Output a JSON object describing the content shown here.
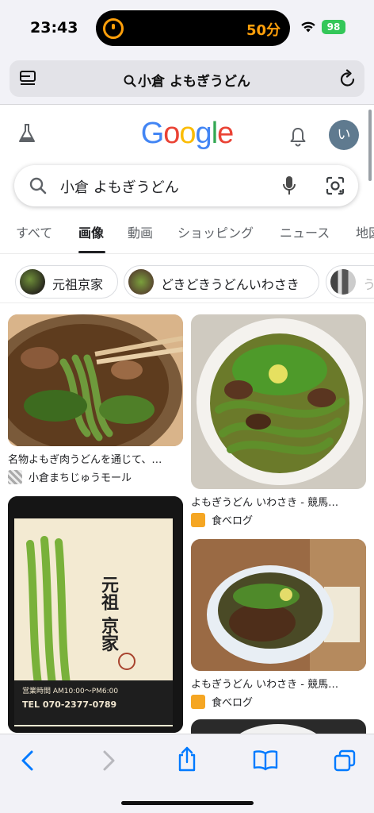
{
  "status_bar": {
    "time": "23:43",
    "activity_text": "50分",
    "battery": "98"
  },
  "browser": {
    "url_text": "小倉 よもぎうどん"
  },
  "google": {
    "logo_letters": [
      "G",
      "o",
      "o",
      "g",
      "l",
      "e"
    ],
    "logo_colors": [
      "#4285F4",
      "#EA4335",
      "#FBBC05",
      "#4285F4",
      "#34A853",
      "#EA4335"
    ],
    "avatar_initial": "い",
    "search_query": "小倉 よもぎうどん"
  },
  "tabs": [
    "すべて",
    "画像",
    "動画",
    "ショッピング",
    "ニュース",
    "地図"
  ],
  "active_tab": "画像",
  "chips": [
    {
      "label": "元祖京家"
    },
    {
      "label": "どきどきうどんいわさき"
    },
    {
      "label": "う"
    }
  ],
  "results": [
    {
      "caption": "名物よもぎ肉うどんを通じて、…",
      "source": "小倉まちじゅうモール"
    },
    {
      "caption": "よもぎうどん いわさき - 競馬…",
      "source": "食べログ"
    },
    {
      "caption": "よもぎうどん いわさき - 競馬…",
      "source": "食べログ"
    }
  ],
  "poster_text": {
    "shop_name": "元祖 京家",
    "hours": "営業時間 AM10:00〜PM6:00",
    "phone": "TEL 070-2377-0789"
  },
  "colors": {
    "accent_orange": "#ff9f0a",
    "ios_blue": "#007aff",
    "tabelog_orange": "#f5a623"
  }
}
